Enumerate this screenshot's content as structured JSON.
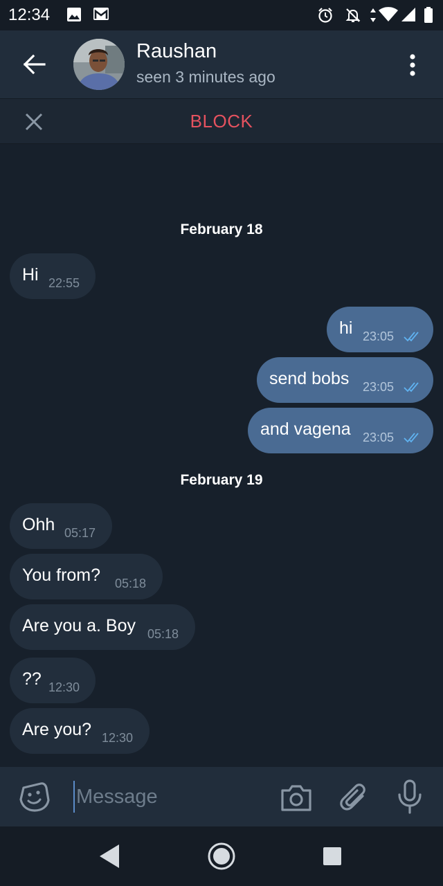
{
  "status_bar": {
    "time": "12:34"
  },
  "header": {
    "contact_name": "Raushan",
    "last_seen": "seen 3 minutes ago"
  },
  "block_bar": {
    "block_label": "BLOCK"
  },
  "chat": {
    "date_separators": [
      "February 18",
      "February 19"
    ],
    "messages": [
      {
        "direction": "in",
        "text": "Hi",
        "time": "22:55"
      },
      {
        "direction": "out",
        "text": "hi",
        "time": "23:05",
        "status": "read"
      },
      {
        "direction": "out",
        "text": "send bobs",
        "time": "23:05",
        "status": "read"
      },
      {
        "direction": "out",
        "text": "and vagena",
        "time": "23:05",
        "status": "read"
      },
      {
        "direction": "in",
        "text": "Ohh",
        "time": "05:17"
      },
      {
        "direction": "in",
        "text": "You from?",
        "time": "05:18"
      },
      {
        "direction": "in",
        "text": "Are you a. Boy",
        "time": "05:18"
      },
      {
        "direction": "in",
        "text": "??",
        "time": "12:30"
      },
      {
        "direction": "in",
        "text": "Are you?",
        "time": "12:30"
      }
    ]
  },
  "composer": {
    "placeholder": "Message"
  },
  "colors": {
    "background": "#17202b",
    "header": "#212d3b",
    "incoming_bubble": "#222e3c",
    "outgoing_bubble": "#4a6b93",
    "block_red": "#e5525f",
    "read_tick": "#5fb2f0"
  }
}
